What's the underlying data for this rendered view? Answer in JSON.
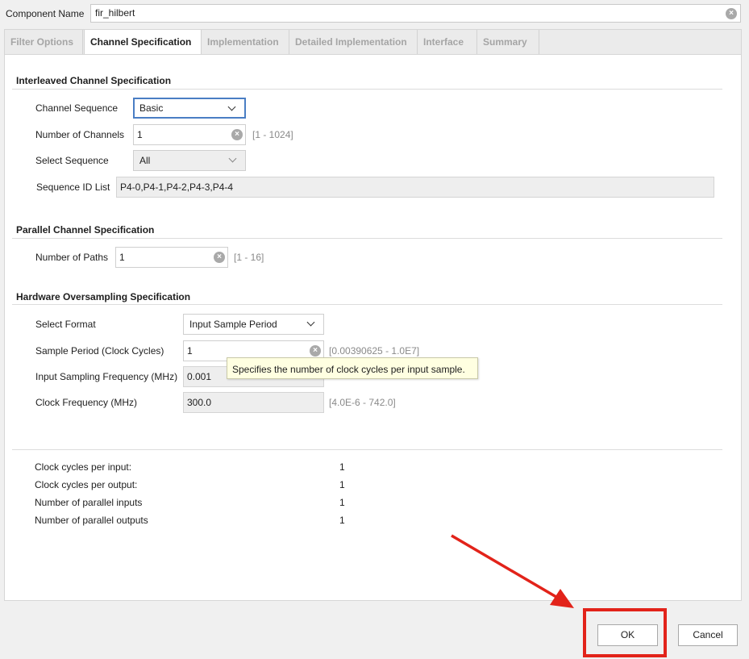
{
  "header": {
    "component_label": "Component Name",
    "component_value": "fir_hilbert"
  },
  "tabs": [
    {
      "label": "Filter Options",
      "active": false
    },
    {
      "label": "Channel Specification",
      "active": true
    },
    {
      "label": "Implementation",
      "active": false
    },
    {
      "label": "Detailed Implementation",
      "active": false
    },
    {
      "label": "Interface",
      "active": false
    },
    {
      "label": "Summary",
      "active": false
    }
  ],
  "interleaved": {
    "title": "Interleaved Channel Specification",
    "channel_sequence_label": "Channel Sequence",
    "channel_sequence_value": "Basic",
    "num_channels_label": "Number of Channels",
    "num_channels_value": "1",
    "num_channels_range": "[1 - 1024]",
    "select_sequence_label": "Select Sequence",
    "select_sequence_value": "All",
    "seq_id_label": "Sequence ID List",
    "seq_id_value": "P4-0,P4-1,P4-2,P4-3,P4-4"
  },
  "parallel": {
    "title": "Parallel Channel Specification",
    "num_paths_label": "Number of Paths",
    "num_paths_value": "1",
    "num_paths_range": "[1 - 16]"
  },
  "oversampling": {
    "title": "Hardware Oversampling Specification",
    "select_format_label": "Select Format",
    "select_format_value": "Input Sample Period",
    "sample_period_label": "Sample Period (Clock Cycles)",
    "sample_period_value": "1",
    "sample_period_range": "[0.00390625 - 1.0E7]",
    "input_freq_label": "Input Sampling Frequency (MHz)",
    "input_freq_value": "0.001",
    "clock_freq_label": "Clock Frequency (MHz)",
    "clock_freq_value": "300.0",
    "clock_freq_range": "[4.0E-6 - 742.0]"
  },
  "tooltip": "Specifies the number of clock cycles per input sample.",
  "summary": [
    {
      "label": "Clock cycles per input:",
      "value": "1"
    },
    {
      "label": "Clock cycles per output:",
      "value": "1"
    },
    {
      "label": "Number of parallel inputs",
      "value": "1"
    },
    {
      "label": "Number of parallel outputs",
      "value": "1"
    }
  ],
  "buttons": {
    "ok": "OK",
    "cancel": "Cancel"
  },
  "colors": {
    "highlight": "#e2231a",
    "focus_border": "#4a7ec4",
    "tooltip_bg": "#ffffe1"
  },
  "icons": {
    "clear": "clear-circle-x-icon",
    "dropdown": "chevron-down-icon",
    "annotation": "red-arrow-pointer"
  }
}
